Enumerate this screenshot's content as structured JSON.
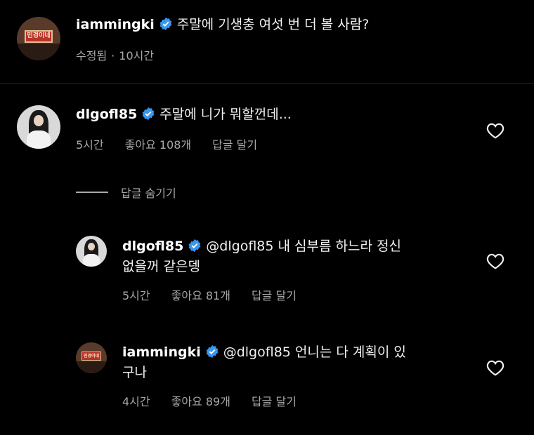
{
  "caption": {
    "username": "iammingki",
    "text": "주말에 기생충 여섯 번 더 볼 사람?",
    "edited": "수정됨",
    "separator": "·",
    "time": "10시간"
  },
  "comment1": {
    "username": "dlgofl85",
    "text": "주말에 니가 뭐할껀데...",
    "time": "5시간",
    "likes": "좋아요 108개",
    "reply": "답글 달기"
  },
  "hide_replies": "답글 숨기기",
  "reply1": {
    "username": "dlgofl85",
    "text_line1": "@dlgofl85 내 심부름 하느라 정신",
    "text_line2": "없을꺼 같은뎅",
    "time": "5시간",
    "likes": "좋아요 81개",
    "reply": "답글 달기"
  },
  "reply2": {
    "username": "iammingki",
    "text_line1": "@dlgofl85 언니는 다 계획이 있",
    "text_line2": "구나",
    "time": "4시간",
    "likes": "좋아요 89개",
    "reply": "답글 달기"
  },
  "avatar_sign_text": "민경이네",
  "icons": {
    "verified": "verified-badge-icon",
    "like": "heart-outline-icon"
  },
  "colors": {
    "background": "#000000",
    "verified": "#3897f0",
    "secondary_text": "#a8a8a8"
  }
}
